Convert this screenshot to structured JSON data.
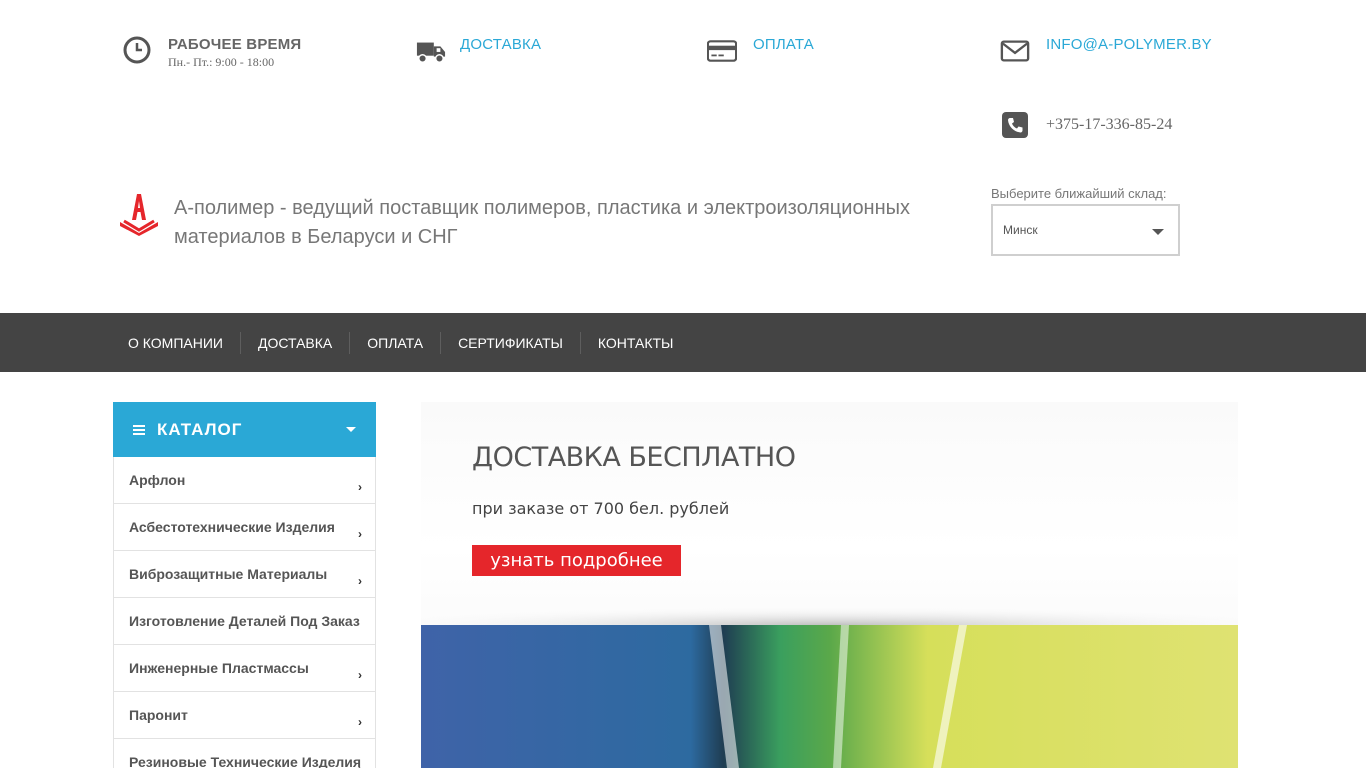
{
  "topbar": {
    "hours": {
      "title": "РАБОЧЕЕ ВРЕМЯ",
      "subtitle": "Пн.- Пт.: 9:00 - 18:00",
      "icon": "clock-icon"
    },
    "delivery": {
      "label": "ДОСТАВКА",
      "icon": "truck-icon"
    },
    "payment": {
      "label": "ОПЛАТА",
      "icon": "credit-card-icon"
    },
    "email": {
      "label": "INFO@A-POLYMER.BY",
      "icon": "envelope-icon"
    },
    "phone": {
      "label": "+375-17-336-85-24",
      "icon": "phone-icon"
    }
  },
  "brand": {
    "tagline": "А-полимер - ведущий поставщик полимеров, пластика и электроизоляционных материалов в Беларуси и СНГ",
    "logo_letter": "А",
    "logo_color": "#e5262b"
  },
  "store": {
    "label": "Выберите ближайший склад:",
    "selected": "Минск"
  },
  "nav": {
    "items": [
      "О КОМПАНИИ",
      "ДОСТАВКА",
      "ОПЛАТА",
      "СЕРТИФИКАТЫ",
      "КОНТАКТЫ"
    ]
  },
  "catalog": {
    "title": "КАТАЛОГ",
    "accent": "#2aa8d6",
    "items": [
      "Арфлон",
      "Асбестотехнические Изделия",
      "Виброзащитные Материалы",
      "Изготовление Деталей Под Заказ",
      "Инженерные Пластмассы",
      "Паронит",
      "Резиновые Технические Изделия"
    ]
  },
  "banner": {
    "title": "ДОСТАВКА БЕСПЛАТНО",
    "subtitle": "при заказе от 700 бел. рублей",
    "button": "узнать подробнее",
    "button_color": "#e5262b"
  },
  "colors": {
    "link": "#2aa8d6",
    "nav_bg": "#444444"
  }
}
